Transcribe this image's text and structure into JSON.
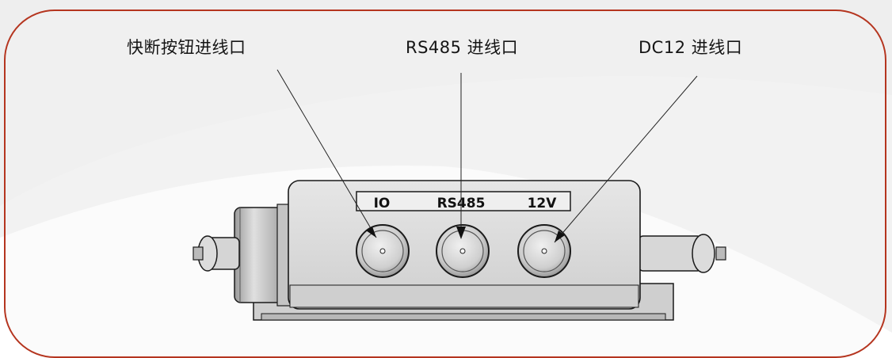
{
  "labels": {
    "button_inlet": "快断按钮进线口",
    "rs485_inlet": "RS485 进线口",
    "dc12_inlet": "DC12 进线口"
  },
  "panel": {
    "io": "IO",
    "rs485": "RS485",
    "v12": "12V"
  },
  "colors": {
    "frame": "#b5351f",
    "text": "#151515",
    "metal": "#d7d7d7"
  }
}
